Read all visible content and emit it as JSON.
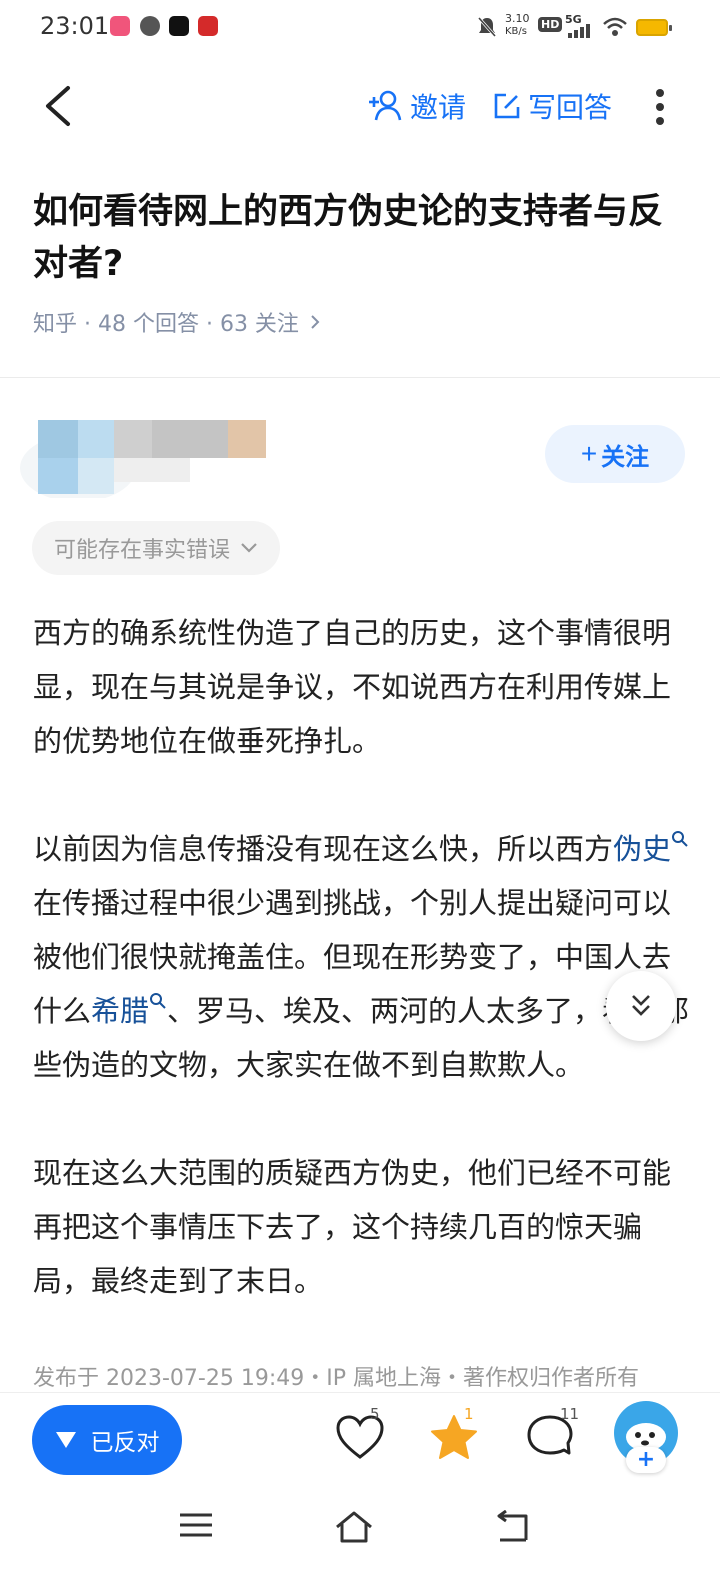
{
  "status_bar": {
    "time": "23:01",
    "speed_value": "3.10",
    "speed_unit": "KB/s",
    "hd": "HD",
    "network": "5G",
    "icons": [
      "app-icon-red",
      "zhihu-icon",
      "douyin-icon",
      "news-app-icon",
      "mute-icon",
      "signal-icon",
      "wifi-icon",
      "battery-icon"
    ]
  },
  "nav": {
    "invite_label": "邀请",
    "write_answer_label": "写回答"
  },
  "question": {
    "title": "如何看待网上的西方伪史论的支持者与反对者?",
    "meta": "知乎 · 48 个回答 · 63 关注"
  },
  "author": {
    "follow_label": "关注"
  },
  "fact_warning": "可能存在事实错误",
  "answer": {
    "p1": "西方的确系统性伪造了自己的历史，这个事情很明显，现在与其说是争议，不如说西方在利用传媒上的优势地位在做垂死挣扎。",
    "p2_a": "以前因为信息传播没有现在这么快，所以西方",
    "p2_kw1": "伪史",
    "p2_b": "在传播过程中很少遇到挑战，个别人提出疑问可以被他们很快就掩盖住。但现在形势变了，中国人去什么",
    "p2_kw2": "希腊",
    "p2_c": "、罗马、埃及、两河的人太多了，看着那些伪造的文物，大家实在做不到自欺欺人。",
    "p3": "现在这么大范围的质疑西方伪史，他们已经不可能再把这个事情压下去了，这个持续几百的惊天骗局，最终走到了末日。",
    "published": "发布于 2023-07-25 19:49・IP 属地上海・著作权归作者所有"
  },
  "actions": {
    "opposed_label": "已反对",
    "like_count": "5",
    "favorite_count": "1",
    "comment_count": "11"
  },
  "colors": {
    "accent": "#1772f6",
    "keyword": "#175199",
    "favorite": "#f6a623"
  }
}
